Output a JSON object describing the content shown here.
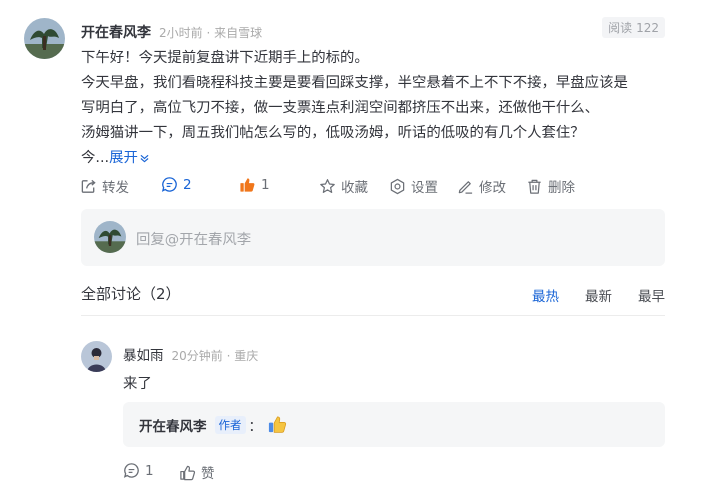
{
  "post": {
    "author": "开在春风李",
    "meta": "2小时前 · 来自雪球",
    "read_label": "阅读",
    "read_count": "122",
    "lines": [
      "下午好！今天提前复盘讲下近期手上的标的。",
      "今天早盘，我们看晓程科技主要是要看回踩支撑，半空悬着不上不下不接，早盘应该是",
      "写明白了，高位飞刀不接，做一支票连点利润空间都挤压不出来，还做他干什么、",
      "汤姆猫讲一下，周五我们帖怎么写的，低吸汤姆，听话的低吸的有几个人套住？"
    ],
    "truncated": "今...",
    "expand_label": "展开"
  },
  "actions": {
    "repost": "转发",
    "comment_count": "2",
    "like_count": "1",
    "favorite": "收藏",
    "settings": "设置",
    "edit": "修改",
    "delete": "删除"
  },
  "reply_box": {
    "placeholder": "回复@开在春风李"
  },
  "discussion": {
    "title": "全部讨论（2）",
    "sort_tabs": [
      {
        "label": "最热",
        "active": true
      },
      {
        "label": "最新",
        "active": false
      },
      {
        "label": "最早",
        "active": false
      }
    ]
  },
  "comment": {
    "author": "暴如雨",
    "meta": "20分钟前 · 重庆",
    "text": "来了",
    "author_reply": {
      "name": "开在春风李",
      "tag": "作者",
      "colon": "："
    },
    "reply_count": "1",
    "like_label": "赞"
  },
  "colors": {
    "accent": "#1a65d6",
    "like_orange": "#f0761b",
    "muted": "#aaaaaa"
  },
  "icons": [
    "repost-icon",
    "comment-icon",
    "like-icon",
    "star-icon",
    "settings-icon",
    "edit-icon",
    "trash-icon",
    "chevron-down-icon",
    "thumbs-up-emoji"
  ]
}
